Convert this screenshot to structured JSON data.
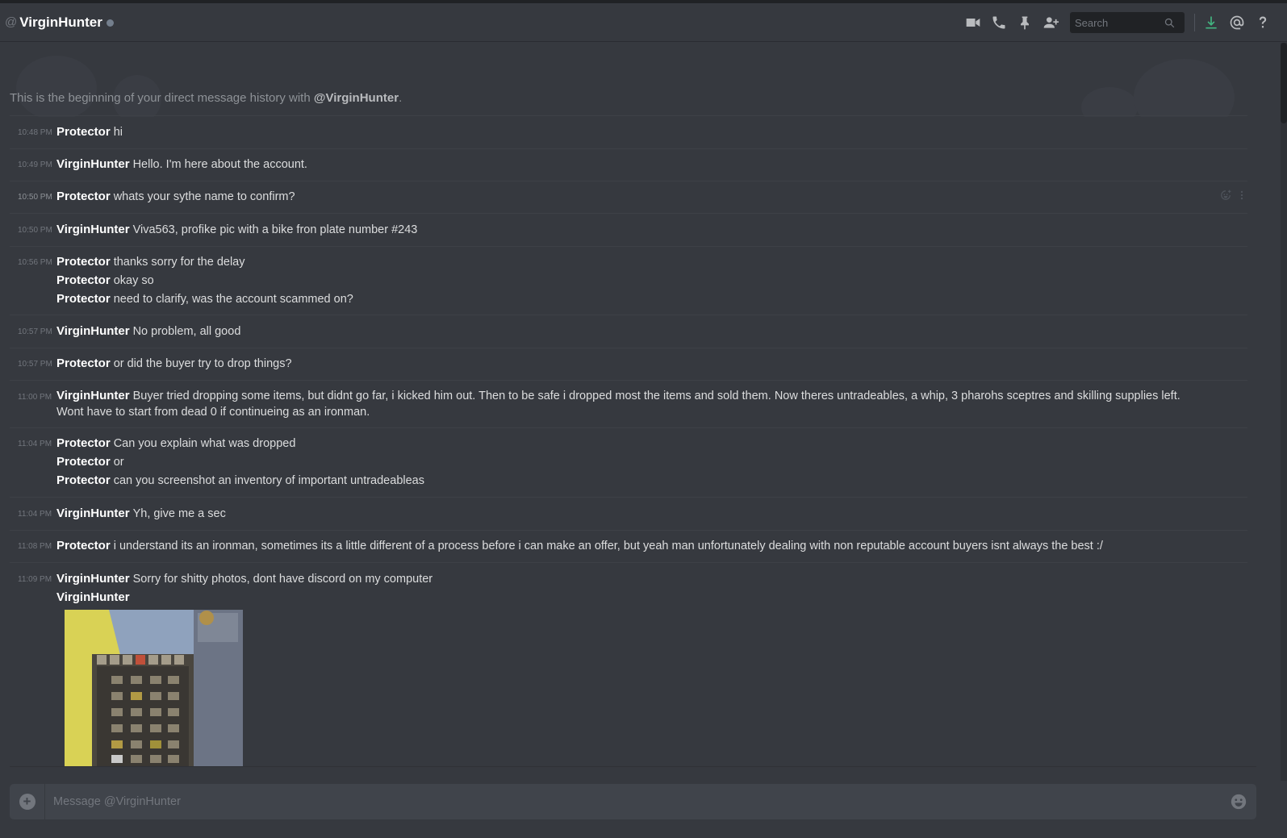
{
  "header": {
    "at_symbol": "@",
    "channel_name": "VirginHunter",
    "search_placeholder": "Search"
  },
  "welcome": {
    "prefix": "This is the beginning of your direct message history with ",
    "handle": "@VirginHunter",
    "suffix": "."
  },
  "messages": [
    {
      "time": "10:48 PM",
      "lines": [
        {
          "author": "Protector",
          "text": "hi"
        }
      ]
    },
    {
      "time": "10:49 PM",
      "lines": [
        {
          "author": "VirginHunter",
          "text": "Hello. I'm here about the account."
        }
      ]
    },
    {
      "time": "10:50 PM",
      "lines": [
        {
          "author": "Protector",
          "text": "whats your sythe name to confirm?"
        }
      ]
    },
    {
      "time": "10:50 PM",
      "lines": [
        {
          "author": "VirginHunter",
          "text": "Viva563, profike pic with a bike fron plate number #243"
        }
      ]
    },
    {
      "time": "10:56 PM",
      "lines": [
        {
          "author": "Protector",
          "text": "thanks sorry for the delay"
        },
        {
          "author": "Protector",
          "text": "okay so"
        },
        {
          "author": "Protector",
          "text": "need to clarify, was the account scammed on?"
        }
      ]
    },
    {
      "time": "10:57 PM",
      "lines": [
        {
          "author": "VirginHunter",
          "text": "No problem, all good"
        }
      ]
    },
    {
      "time": "10:57 PM",
      "lines": [
        {
          "author": "Protector",
          "text": "or did the buyer try to drop things?"
        }
      ]
    },
    {
      "time": "11:00 PM",
      "lines": [
        {
          "author": "VirginHunter",
          "text": "Buyer tried dropping some items, but didnt go far, i kicked him out. Then to be safe i dropped most the items and sold them. Now theres untradeables, a whip, 3 pharohs sceptres and skilling supplies left. Wont have to start from dead 0 if continueing as an ironman."
        }
      ]
    },
    {
      "time": "11:04 PM",
      "lines": [
        {
          "author": "Protector",
          "text": "Can you explain what was dropped"
        },
        {
          "author": "Protector",
          "text": "or"
        },
        {
          "author": "Protector",
          "text": "can you screenshot an inventory of important untradeableas"
        }
      ]
    },
    {
      "time": "11:04 PM",
      "lines": [
        {
          "author": "VirginHunter",
          "text": "Yh, give me a sec"
        }
      ]
    },
    {
      "time": "11:08 PM",
      "lines": [
        {
          "author": "Protector",
          "text": "i understand its an ironman, sometimes its a little different of a process before i can make an offer, but yeah man unfortunately dealing with non reputable account buyers isnt always the best :/"
        }
      ]
    },
    {
      "time": "11:09 PM",
      "lines": [
        {
          "author": "VirginHunter",
          "text": "Sorry for shitty photos, dont have discord on my computer"
        },
        {
          "author": "VirginHunter",
          "text": ""
        }
      ]
    }
  ],
  "composer": {
    "placeholder": "Message @VirginHunter",
    "plus_label": "+"
  },
  "colors": {
    "background": "#36393f",
    "input": "#40444b",
    "author": "#ffffff",
    "status_offline": "#747f8d",
    "download_green": "#43b581"
  },
  "icons": [
    "video-call-icon",
    "voice-call-icon",
    "pin-icon",
    "add-friend-icon",
    "search-icon",
    "download-icon",
    "mention-icon",
    "help-icon",
    "add-reaction-icon",
    "more-options-icon",
    "add-attachment-icon",
    "emoji-icon"
  ]
}
